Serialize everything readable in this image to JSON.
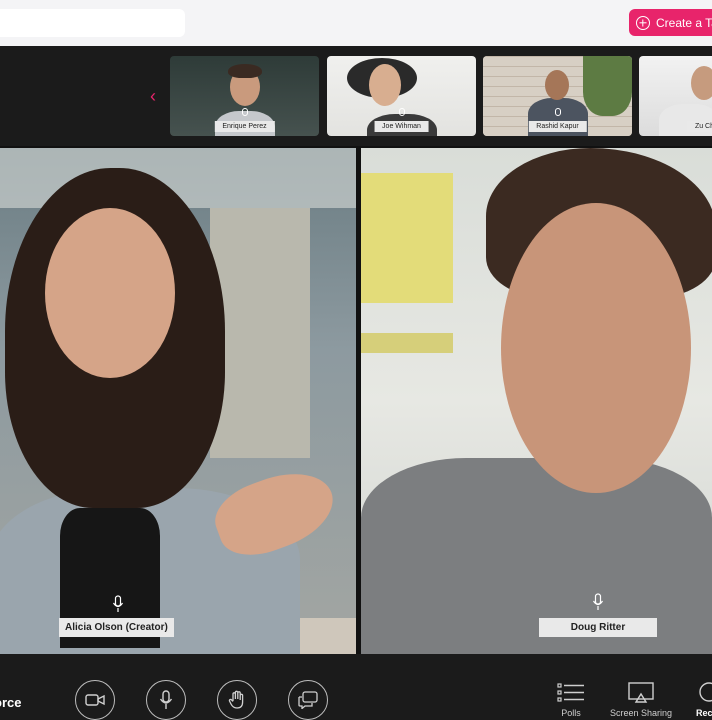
{
  "header": {
    "create_label": "Create a Ta",
    "search_placeholder": ""
  },
  "thumbnails": [
    {
      "name": "Enrique Perez"
    },
    {
      "name": "Joe Wihman"
    },
    {
      "name": "Rashid Kapur"
    },
    {
      "name": "Zu Ch"
    }
  ],
  "main": {
    "left_name": "Alicia Olson (Creator)",
    "right_name": "Doug Ritter"
  },
  "toolbar": {
    "brand": "orce",
    "polls_label": "Polls",
    "screen_sharing_label": "Screen Sharing",
    "record_label": "Rec"
  },
  "colors": {
    "accent": "#e8246b",
    "background": "#111111"
  }
}
